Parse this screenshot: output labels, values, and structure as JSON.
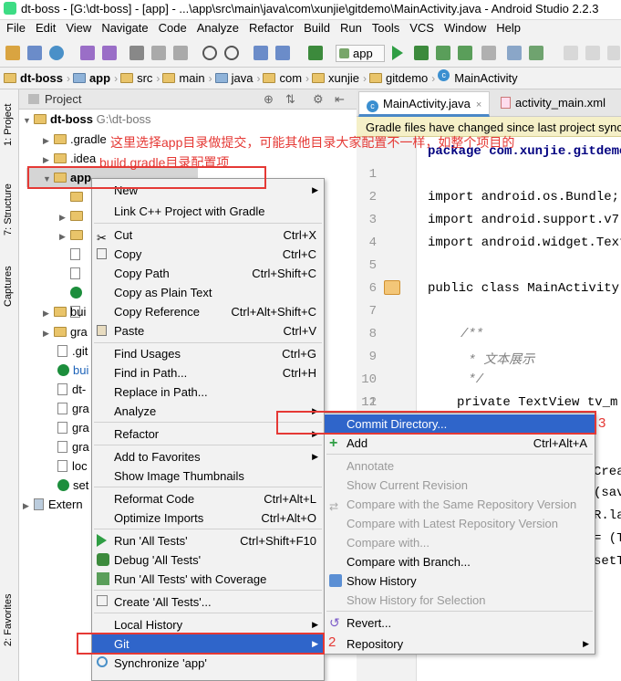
{
  "window": {
    "title": "dt-boss - [G:\\dt-boss] - [app] - ...\\app\\src\\main\\java\\com\\xunjie\\gitdemo\\MainActivity.java - Android Studio 2.2.3"
  },
  "menubar": [
    "File",
    "Edit",
    "View",
    "Navigate",
    "Code",
    "Analyze",
    "Refactor",
    "Build",
    "Run",
    "Tools",
    "VCS",
    "Window",
    "Help"
  ],
  "toolbar": {
    "run_config": "app",
    "vcs_label": "VCS"
  },
  "breadcrumbs": [
    "dt-boss",
    "app",
    "src",
    "main",
    "java",
    "com",
    "xunjie",
    "gitdemo",
    "MainActivity"
  ],
  "side_tabs": {
    "project": "1: Project",
    "structure": "7: Structure",
    "captures": "Captures",
    "favorites": "2: Favorites"
  },
  "project_panel": {
    "title": "Project",
    "rows": [
      {
        "label": "dt-boss",
        "path": "G:\\dt-boss"
      },
      {
        "label": ".gradle"
      },
      {
        "label": ".idea"
      },
      {
        "label": "app"
      },
      {
        "label": "bui"
      },
      {
        "label": "gra"
      },
      {
        "label": ".git"
      },
      {
        "label": "bui"
      },
      {
        "label": "dt-"
      },
      {
        "label": "gra"
      },
      {
        "label": "gra"
      },
      {
        "label": "gra"
      },
      {
        "label": "loc"
      },
      {
        "label": "set"
      },
      {
        "label": "Extern"
      }
    ]
  },
  "editor": {
    "tabs": [
      "MainActivity.java",
      "activity_main.xml"
    ],
    "notification": "Gradle files have changed since last project sync",
    "line_numbers": [
      "1",
      "2",
      "3",
      "4",
      "5",
      "6",
      "7",
      "8",
      "9",
      "10",
      "11",
      "12"
    ],
    "lines": {
      "l1": "package com.xunjie.gitdemo",
      "l3": "import android.os.Bundle;",
      "l4": "import android.support.v7.",
      "l5": "import android.widget.Text",
      "l7": "public class MainActivity",
      "l9": "/**",
      "l10": " * 文本展示",
      "l11": " */",
      "l12": "private TextView tv_m"
    },
    "fragments": [
      "Crea",
      "(sav",
      "R.la",
      "= (T",
      "setT"
    ]
  },
  "annotation": {
    "line1": "这里选择app目录做提交，可能其他目录大家配置不一样，如整个项目的",
    "line2": "build.gradle目录配置项",
    "step2": "2",
    "step3": "3"
  },
  "context_menu": [
    {
      "label": "New",
      "submenu": true
    },
    {
      "label": "Link C++ Project with Gradle"
    },
    {
      "label": "Cut",
      "shortcut": "Ctrl+X"
    },
    {
      "label": "Copy",
      "shortcut": "Ctrl+C"
    },
    {
      "label": "Copy Path",
      "shortcut": "Ctrl+Shift+C"
    },
    {
      "label": "Copy as Plain Text"
    },
    {
      "label": "Copy Reference",
      "shortcut": "Ctrl+Alt+Shift+C"
    },
    {
      "label": "Paste",
      "shortcut": "Ctrl+V"
    },
    {
      "label": "Find Usages",
      "shortcut": "Ctrl+G"
    },
    {
      "label": "Find in Path...",
      "shortcut": "Ctrl+H"
    },
    {
      "label": "Replace in Path..."
    },
    {
      "label": "Analyze",
      "submenu": true
    },
    {
      "label": "Refactor",
      "submenu": true
    },
    {
      "label": "Add to Favorites",
      "submenu": true
    },
    {
      "label": "Show Image Thumbnails"
    },
    {
      "label": "Reformat Code",
      "shortcut": "Ctrl+Alt+L"
    },
    {
      "label": "Optimize Imports",
      "shortcut": "Ctrl+Alt+O"
    },
    {
      "label": "Run 'All Tests'",
      "shortcut": "Ctrl+Shift+F10"
    },
    {
      "label": "Debug 'All Tests'"
    },
    {
      "label": "Run 'All Tests' with Coverage"
    },
    {
      "label": "Create 'All Tests'..."
    },
    {
      "label": "Local History",
      "submenu": true
    },
    {
      "label": "Git",
      "submenu": true
    },
    {
      "label": "Synchronize 'app'"
    }
  ],
  "git_submenu": [
    {
      "label": "Commit Directory..."
    },
    {
      "label": "Add",
      "shortcut": "Ctrl+Alt+A"
    },
    {
      "label": "Annotate"
    },
    {
      "label": "Show Current Revision"
    },
    {
      "label": "Compare with the Same Repository Version"
    },
    {
      "label": "Compare with Latest Repository Version"
    },
    {
      "label": "Compare with..."
    },
    {
      "label": "Compare with Branch..."
    },
    {
      "label": "Show History"
    },
    {
      "label": "Show History for Selection"
    },
    {
      "label": "Revert..."
    },
    {
      "label": "Repository",
      "submenu": true
    }
  ],
  "colors": {
    "selection": "#2f65ca",
    "highlight_box": "#e53935",
    "keyword": "#000080"
  }
}
